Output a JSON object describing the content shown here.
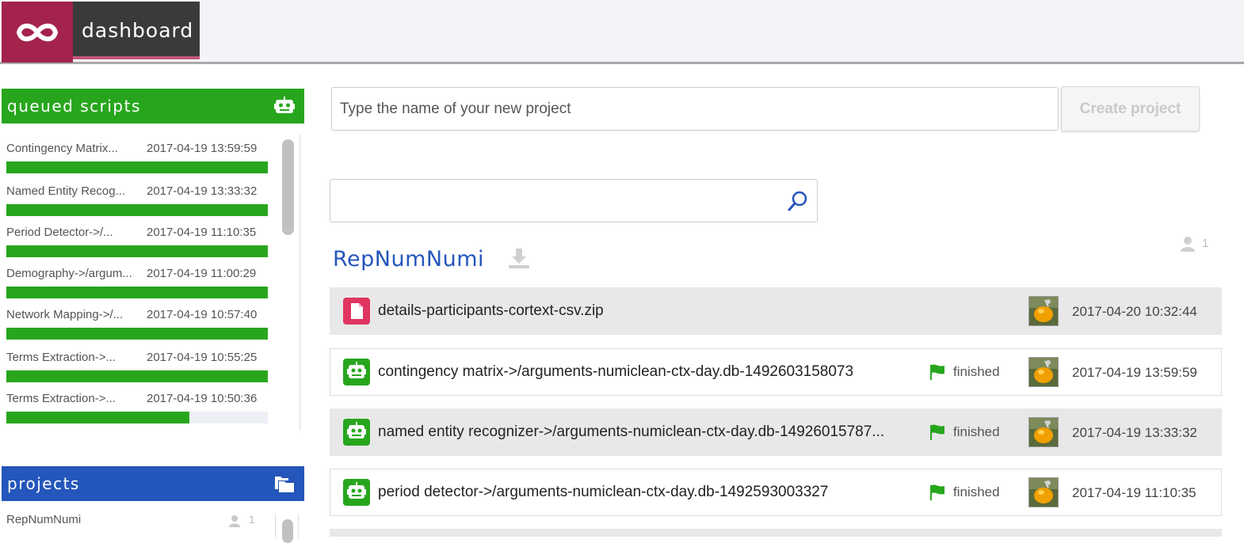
{
  "topbar": {
    "logo_icon": "infinity-logo-icon",
    "brand": "dashboard",
    "brand_color": "#a4234c"
  },
  "queued": {
    "title": "queued scripts",
    "icon": "robot-icon",
    "color": "#27a61d",
    "items": [
      {
        "name": "Contingency Matrix...",
        "time": "2017-04-19 13:59:59",
        "progress": 1.0
      },
      {
        "name": "Named Entity Recog...",
        "time": "2017-04-19 13:33:32",
        "progress": 1.0
      },
      {
        "name": "Period Detector->/...",
        "time": "2017-04-19 11:10:35",
        "progress": 1.0
      },
      {
        "name": "Demography->/argum...",
        "time": "2017-04-19 11:00:29",
        "progress": 1.0
      },
      {
        "name": "Network Mapping->/...",
        "time": "2017-04-19 10:57:40",
        "progress": 1.0
      },
      {
        "name": "Terms Extraction->...",
        "time": "2017-04-19 10:55:25",
        "progress": 1.0
      },
      {
        "name": "Terms Extraction->...",
        "time": "2017-04-19 10:50:36",
        "progress": 0.7
      }
    ]
  },
  "projects_panel": {
    "title": "projects",
    "icon": "folders-icon",
    "color": "#2456bb",
    "items": [
      {
        "name": "RepNumNumi",
        "members": "1"
      }
    ]
  },
  "new_project": {
    "placeholder": "Type the name of your new project",
    "button": "Create project"
  },
  "search": {
    "value": "",
    "icon": "search-icon"
  },
  "project": {
    "title": "RepNumNumi",
    "members": "1",
    "files": [
      {
        "name": "details-participants-cortext-csv.zip",
        "type": "file",
        "status": "",
        "time": "2017-04-20 10:32:44"
      },
      {
        "name": "contingency matrix->/arguments-numiclean-ctx-day.db-1492603158073",
        "type": "script",
        "status": "finished",
        "time": "2017-04-19 13:59:59"
      },
      {
        "name": "named entity recognizer->/arguments-numiclean-ctx-day.db-14926015787...",
        "type": "script",
        "status": "finished",
        "time": "2017-04-19 13:33:32"
      },
      {
        "name": "period detector->/arguments-numiclean-ctx-day.db-1492593003327",
        "type": "script",
        "status": "finished",
        "time": "2017-04-19 11:10:35"
      }
    ]
  }
}
